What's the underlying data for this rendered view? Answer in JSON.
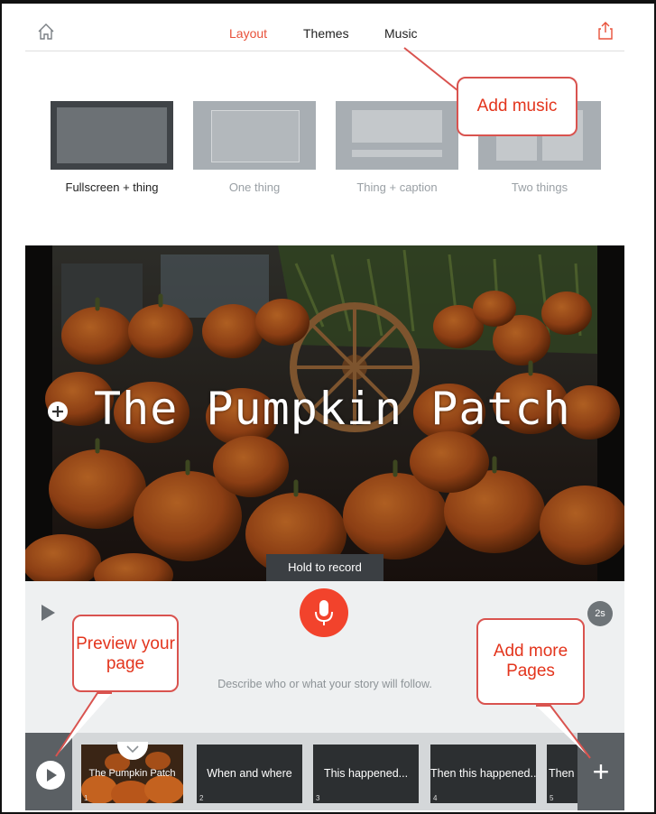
{
  "nav": {
    "tabs": [
      {
        "label": "Layout",
        "active": true
      },
      {
        "label": "Themes",
        "active": false
      },
      {
        "label": "Music",
        "active": false
      }
    ],
    "home_icon": "home-icon",
    "share_icon": "share-icon"
  },
  "layouts": [
    {
      "label": "Fullscreen + thing",
      "selected": true
    },
    {
      "label": "One thing",
      "selected": false
    },
    {
      "label": "Thing + caption",
      "selected": false
    },
    {
      "label": "Two things",
      "selected": false
    }
  ],
  "stage": {
    "title": "The Pumpkin Patch",
    "add_icon": "plus-circle-icon"
  },
  "recorder": {
    "tooltip": "Hold to record",
    "mic_icon": "microphone-icon",
    "duration": "2s",
    "prompt": "Describe who or what your story will follow."
  },
  "filmstrip": {
    "pages": [
      {
        "label": "The Pumpkin Patch",
        "number": "1"
      },
      {
        "label": "When and where",
        "number": "2"
      },
      {
        "label": "This happened...",
        "number": "3"
      },
      {
        "label": "Then this happened...",
        "number": "4"
      },
      {
        "label": "Then t",
        "number": "5"
      }
    ],
    "add_label": "+"
  },
  "callouts": {
    "music": "Add music",
    "preview": "Preview your page",
    "add_pages": "Add more Pages"
  },
  "colors": {
    "accent": "#e8513a",
    "mic": "#f2432c",
    "callout_text": "#e3351d"
  }
}
